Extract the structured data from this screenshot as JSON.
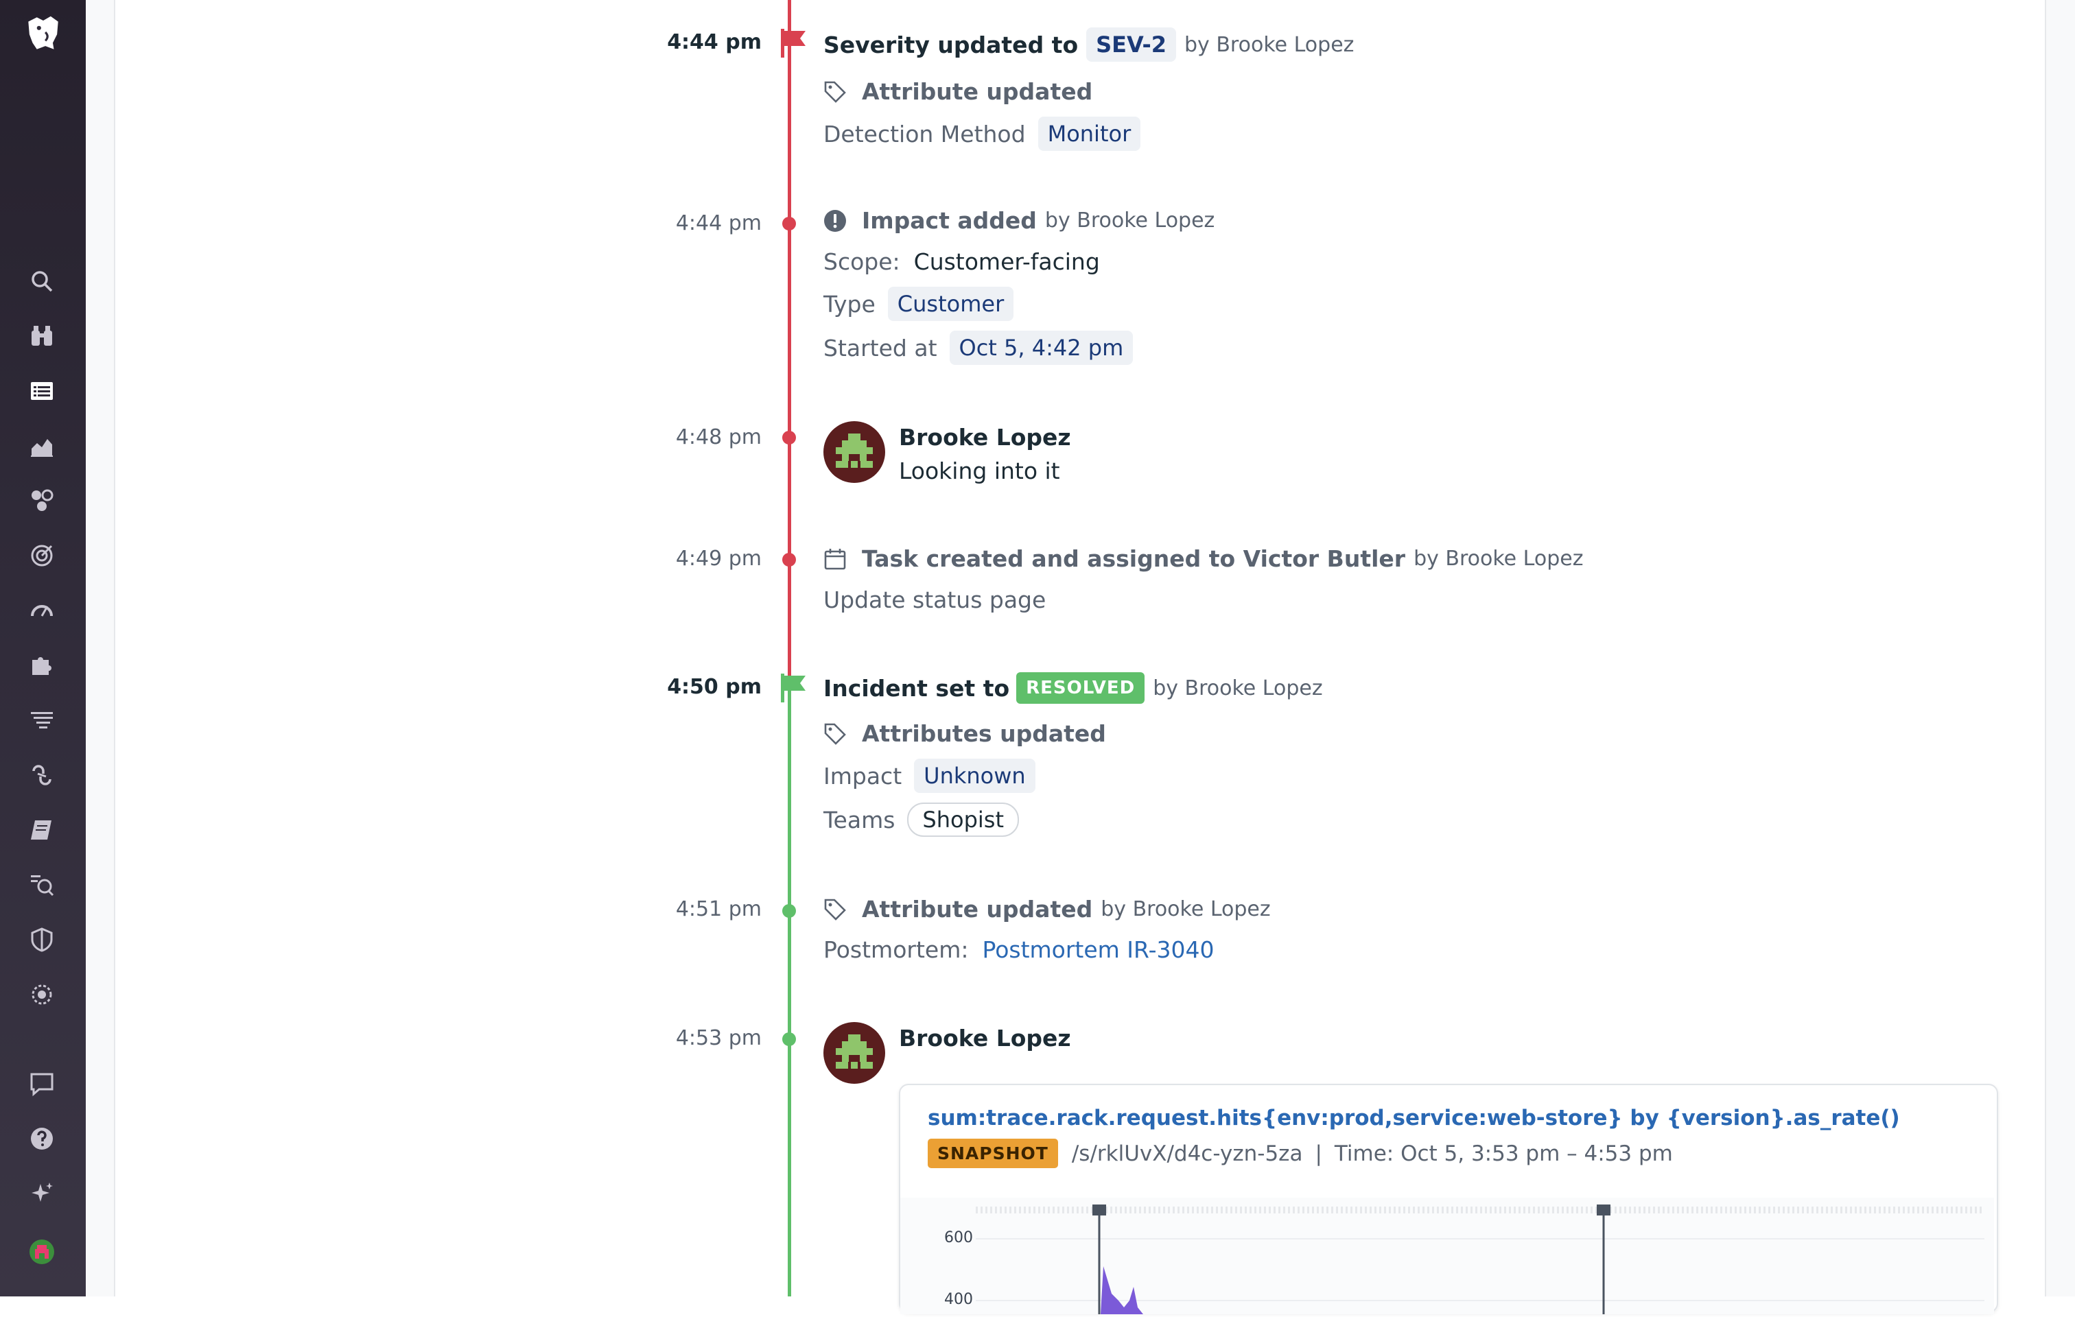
{
  "sidebar": {
    "items": [
      {
        "icon": "datadog-logo-icon"
      },
      {
        "icon": "search-icon"
      },
      {
        "icon": "binoculars-icon"
      },
      {
        "icon": "list-icon"
      },
      {
        "icon": "area-chart-icon"
      },
      {
        "icon": "infrastructure-icon"
      },
      {
        "icon": "target-icon"
      },
      {
        "icon": "speedometer-icon"
      },
      {
        "icon": "puzzle-icon"
      },
      {
        "icon": "filter-icon"
      },
      {
        "icon": "link-icon"
      },
      {
        "icon": "notebook-icon"
      },
      {
        "icon": "synthetics-icon"
      },
      {
        "icon": "shield-icon"
      },
      {
        "icon": "watchdog-icon"
      },
      {
        "icon": "chat-icon"
      },
      {
        "icon": "help-icon"
      },
      {
        "icon": "sparkle-icon"
      },
      {
        "icon": "user-avatar-icon"
      }
    ]
  },
  "timeline": {
    "events": [
      {
        "time": "4:44 pm",
        "title": "Severity updated to",
        "severity": "SEV-2",
        "by": "by Brooke Lopez",
        "sub_title": "Attribute updated",
        "attr_label": "Detection Method",
        "attr_value": "Monitor"
      },
      {
        "time": "4:44 pm",
        "title": "Impact added",
        "by": "by Brooke Lopez",
        "scope_label": "Scope:",
        "scope_value": "Customer-facing",
        "type_label": "Type",
        "type_value": "Customer",
        "started_label": "Started at",
        "started_value": "Oct 5, 4:42 pm"
      },
      {
        "time": "4:48 pm",
        "author": "Brooke Lopez",
        "message": "Looking into it"
      },
      {
        "time": "4:49 pm",
        "title": "Task created and assigned to Victor Butler",
        "by": "by Brooke Lopez",
        "detail": "Update status page"
      },
      {
        "time": "4:50 pm",
        "title": "Incident set to",
        "status": "RESOLVED",
        "by": "by Brooke Lopez",
        "sub_title": "Attributes updated",
        "impact_label": "Impact",
        "impact_value": "Unknown",
        "teams_label": "Teams",
        "teams_value": "Shopist"
      },
      {
        "time": "4:51 pm",
        "title": "Attribute updated",
        "by": "by Brooke Lopez",
        "postmortem_label": "Postmortem:",
        "postmortem_link": "Postmortem IR-3040"
      },
      {
        "time": "4:53 pm",
        "author": "Brooke Lopez",
        "snapshot": {
          "query": "sum:trace.rack.request.hits{env:prod,service:web-store} by {version}.as_rate()",
          "badge": "SNAPSHOT",
          "path": "/s/rklUvX/d4c-yzn-5za",
          "separator": "|",
          "time_range": "Time: Oct 5, 3:53 pm – 4:53 pm",
          "y_ticks": [
            "600",
            "400"
          ]
        }
      }
    ]
  },
  "colors": {
    "timeline_red": "#d9414f",
    "timeline_green": "#5fbf6a",
    "link": "#2a68b3",
    "snapshot_badge": "#eba034"
  }
}
